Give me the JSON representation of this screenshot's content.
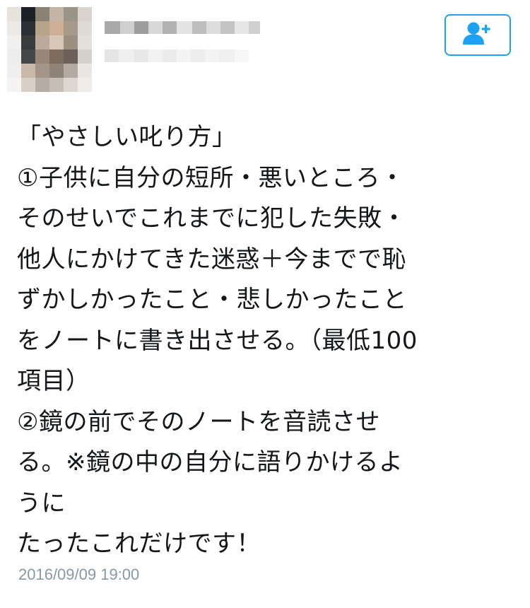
{
  "profile": {
    "avatar_icon": "blurred-avatar",
    "follow_icon": "add-user-icon",
    "accent_color": "#1da1f2"
  },
  "tweet": {
    "lines": [
      "「やさしい叱り方」",
      "①子供に自分の短所・悪いところ・",
      "そのせいでこれまでに犯した失敗・",
      "他人にかけてきた迷惑＋今までで恥",
      "ずかしかったこと・悲しかったこと",
      "をノートに書き出させる。（最低100",
      "項目）",
      "②鏡の前でそのノートを音読させ",
      "る。※鏡の中の自分に語りかけるよ",
      "うに",
      "たったこれだけです！"
    ],
    "timestamp": "2016/09/09 19:00",
    "timestamp_color": "#8899a6"
  }
}
